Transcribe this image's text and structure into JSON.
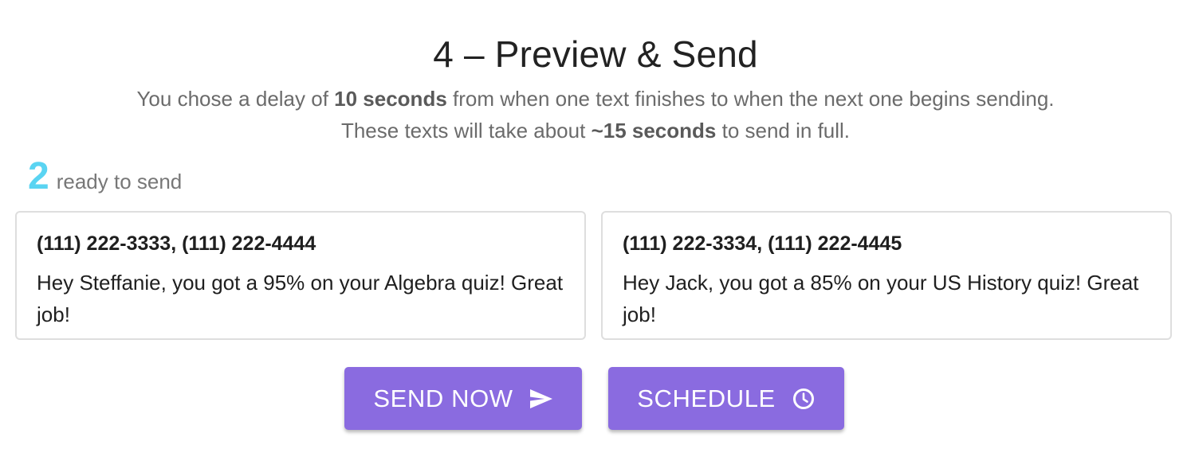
{
  "page": {
    "title": "4 – Preview & Send"
  },
  "delay_info": {
    "line1_prefix": "You chose a delay of ",
    "line1_bold": "10 seconds",
    "line1_suffix": " from when one text finishes to when the next one begins sending.",
    "line2_prefix": "These texts will take about ",
    "line2_bold": "~15 seconds",
    "line2_suffix": " to send in full."
  },
  "ready": {
    "count": "2",
    "label": "ready to send"
  },
  "messages": [
    {
      "phones": "(111) 222-3333, (111) 222-4444",
      "text": "Hey Steffanie, you got a 95% on your Algebra quiz! Great job!"
    },
    {
      "phones": "(111) 222-3334, (111) 222-4445",
      "text": "Hey Jack, you got a 85% on your US History quiz! Great job!"
    }
  ],
  "actions": {
    "send_now_label": "SEND NOW",
    "send_now_icon": "send-icon",
    "schedule_label": "SCHEDULE",
    "schedule_icon": "clock-icon"
  },
  "colors": {
    "accent": "#8a6be0",
    "count": "#5ad4f2"
  }
}
